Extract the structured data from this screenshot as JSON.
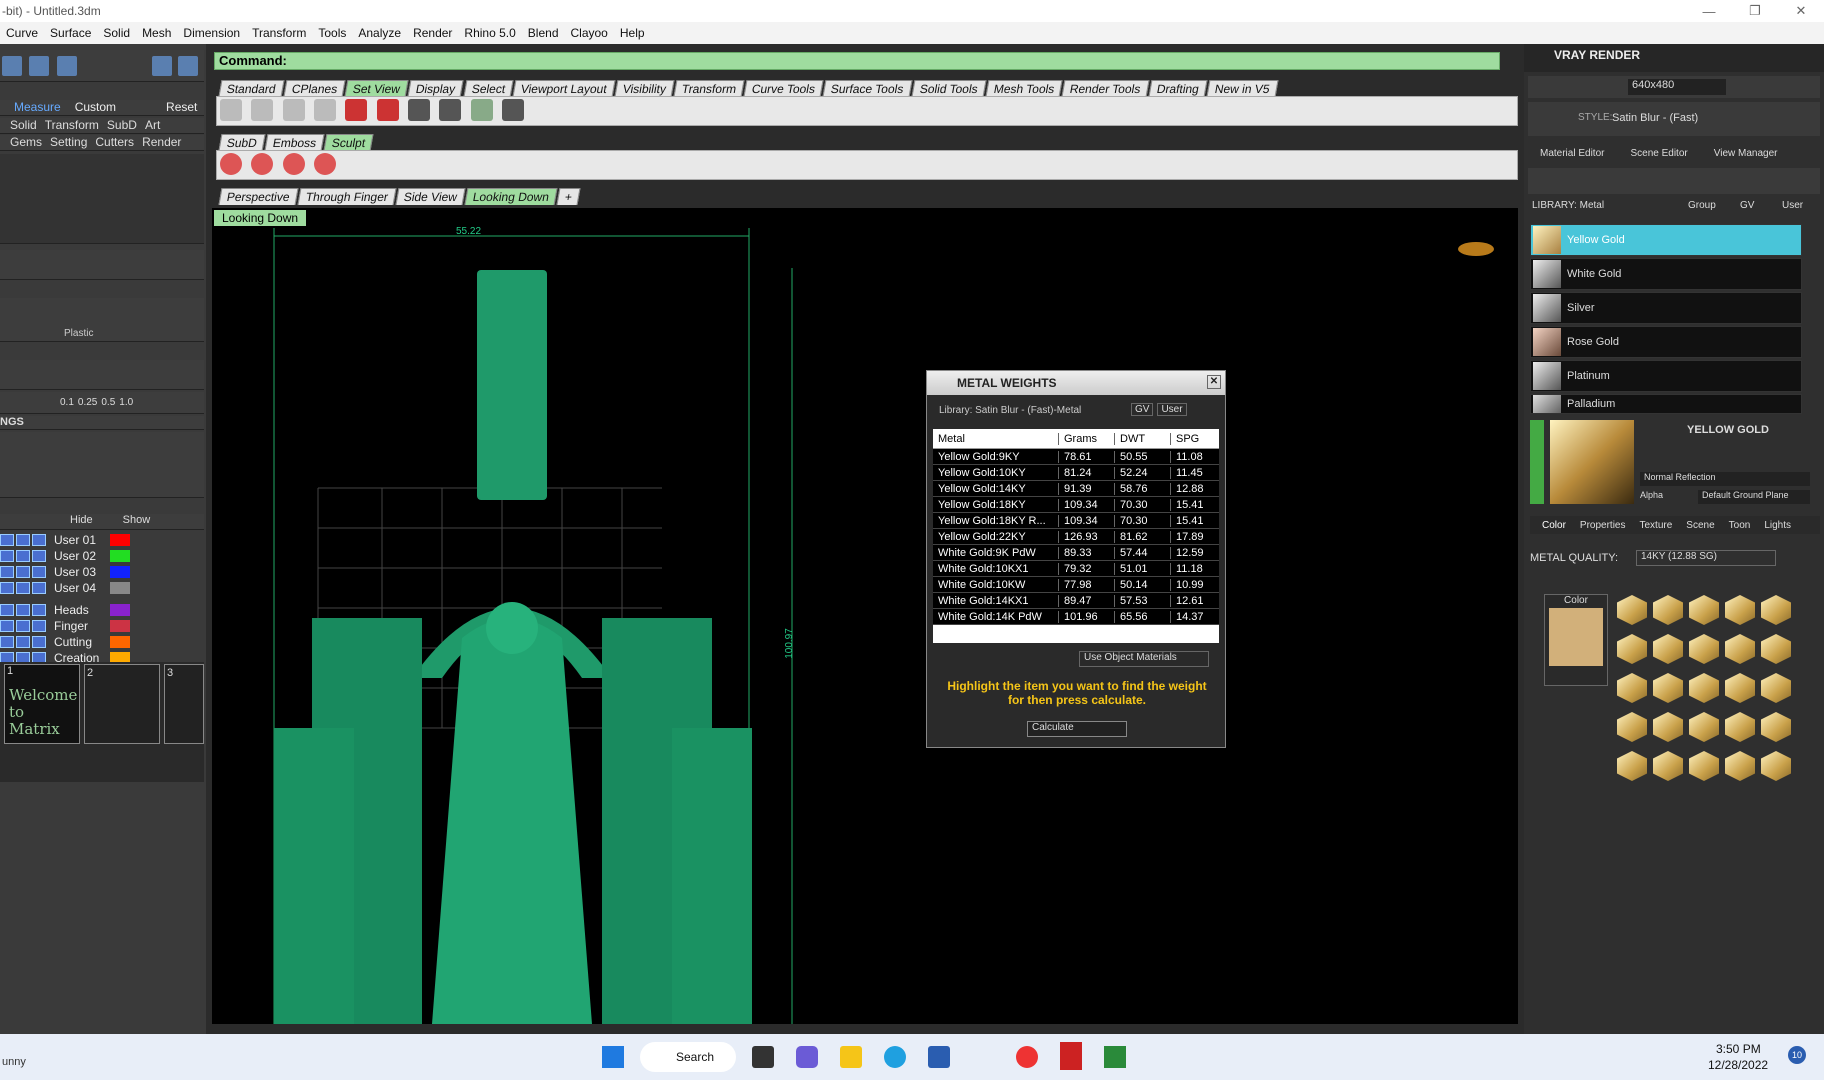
{
  "window": {
    "title": "-bit) - Untitled.3dm"
  },
  "menu": [
    "Curve",
    "Surface",
    "Solid",
    "Mesh",
    "Dimension",
    "Transform",
    "Tools",
    "Analyze",
    "Render",
    "Rhino 5.0",
    "Blend",
    "Clayoo",
    "Help"
  ],
  "command": {
    "label": "Command:"
  },
  "main_tabs": [
    "Standard",
    "CPlanes",
    "Set View",
    "Display",
    "Select",
    "Viewport Layout",
    "Visibility",
    "Transform",
    "Curve Tools",
    "Surface Tools",
    "Solid Tools",
    "Mesh Tools",
    "Render Tools",
    "Drafting",
    "New in V5"
  ],
  "main_tabs_active": "Set View",
  "sub_tabs": [
    "SubD",
    "Emboss",
    "Sculpt"
  ],
  "view_tabs": [
    "Perspective",
    "Through Finger",
    "Side View",
    "Looking Down"
  ],
  "viewport": {
    "label": "Looking Down",
    "dim_width": "55.22",
    "dim_height": "100.97"
  },
  "left": {
    "measure_row": [
      "Measure",
      "Custom",
      "Reset"
    ],
    "cat_row1": [
      "Solid",
      "Transform",
      "SubD",
      "Art"
    ],
    "cat_row2": [
      "Gems",
      "Setting",
      "Cutters",
      "Render"
    ],
    "material_label": "Plastic",
    "steps": [
      "0.1",
      "0.25",
      "0.5",
      "1.0"
    ],
    "section_label": "NGS",
    "hide_label": "Hide",
    "show_label": "Show",
    "layers": [
      {
        "name": "User 01",
        "color": "#ff0000"
      },
      {
        "name": "User 02",
        "color": "#22dd22"
      },
      {
        "name": "User 03",
        "color": "#1122ff"
      },
      {
        "name": "User 04",
        "color": "#888888"
      },
      {
        "name": "Heads",
        "color": "#8822cc"
      },
      {
        "name": "Finger",
        "color": "#cc3344"
      },
      {
        "name": "Cutting",
        "color": "#ff6600"
      },
      {
        "name": "Creation",
        "color": "#ffaa00"
      }
    ],
    "slots": [
      "1",
      "2",
      "3"
    ],
    "welcome": "Welcome to Matrix"
  },
  "dialog": {
    "title": "METAL WEIGHTS",
    "library": "Library: Satin Blur - (Fast)-Metal",
    "gv": "GV",
    "user": "User",
    "headers": [
      "Metal",
      "Grams",
      "DWT",
      "SPG"
    ],
    "rows": [
      [
        "Yellow Gold:9KY",
        "78.61",
        "50.55",
        "11.08"
      ],
      [
        "Yellow Gold:10KY",
        "81.24",
        "52.24",
        "11.45"
      ],
      [
        "Yellow Gold:14KY",
        "91.39",
        "58.76",
        "12.88"
      ],
      [
        "Yellow Gold:18KY",
        "109.34",
        "70.30",
        "15.41"
      ],
      [
        "Yellow Gold:18KY R...",
        "109.34",
        "70.30",
        "15.41"
      ],
      [
        "Yellow Gold:22KY",
        "126.93",
        "81.62",
        "17.89"
      ],
      [
        "White Gold:9K PdW",
        "89.33",
        "57.44",
        "12.59"
      ],
      [
        "White Gold:10KX1",
        "79.32",
        "51.01",
        "11.18"
      ],
      [
        "White Gold:10KW",
        "77.98",
        "50.14",
        "10.99"
      ],
      [
        "White Gold:14KX1",
        "89.47",
        "57.53",
        "12.61"
      ],
      [
        "White Gold:14K PdW",
        "101.96",
        "65.56",
        "14.37"
      ]
    ],
    "use_materials": "Use Object Materials",
    "hint": "Highlight the item you want to find the weight for then press calculate.",
    "calculate": "Calculate"
  },
  "vray": {
    "title": "VRAY RENDER",
    "resolution": "640x480",
    "style_label": "STYLE:",
    "style_value": "Satin Blur - (Fast)",
    "tabs": [
      "Material Editor",
      "Scene Editor",
      "View Manager"
    ],
    "library_label": "LIBRARY: Metal",
    "group": "Group",
    "gv": "GV",
    "user": "User",
    "library_items": [
      "Yellow Gold",
      "White Gold",
      "Silver",
      "Rose Gold",
      "Platinum",
      "Palladium"
    ],
    "selected_name": "YELLOW GOLD",
    "reflection": "Normal Reflection",
    "alpha": "Alpha",
    "ground": "Default Ground Plane",
    "prop_tabs": [
      "Color",
      "Properties",
      "Texture",
      "Scene",
      "Toon",
      "Lights"
    ],
    "quality_label": "METAL QUALITY:",
    "quality_value": "14KY       (12.88 SG)",
    "color_label": "Color"
  },
  "taskbar": {
    "search": "Search",
    "time": "3:50 PM",
    "date": "12/28/2022",
    "badge": "10",
    "weather": "unny"
  }
}
